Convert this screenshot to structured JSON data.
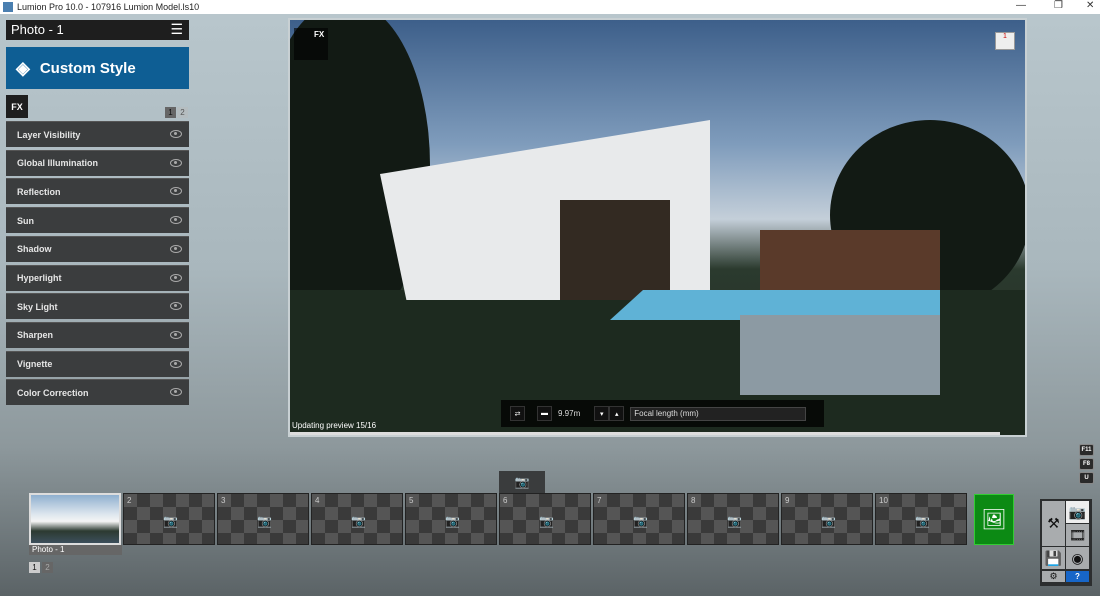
{
  "window": {
    "title": "Lumion Pro 10.0 - 107916 Lumion Model.ls10"
  },
  "panel": {
    "photo_title": "Photo - 1",
    "style_name": "Custom Style",
    "fx_tab": "FX",
    "pages": [
      "1",
      "2"
    ],
    "effects": [
      "Layer Visibility",
      "Global Illumination",
      "Reflection",
      "Sun",
      "Shadow",
      "Hyperlight",
      "Sky Light",
      "Sharpen",
      "Vignette",
      "Color Correction"
    ]
  },
  "viewport": {
    "status": "Updating preview 15/16",
    "fx_badge": "FX",
    "camera_height": "9.97m",
    "focal_length_label": "Focal length (mm)",
    "preview_badge": "1"
  },
  "keys": [
    "F11",
    "F8",
    "U"
  ],
  "filmstrip": {
    "slots": [
      "",
      "2",
      "3",
      "4",
      "5",
      "6",
      "7",
      "8",
      "9",
      "10"
    ],
    "first_label": "Photo - 1",
    "pages": [
      "1",
      "2"
    ]
  },
  "right_panel": {
    "help": "?"
  },
  "colors": {
    "accent": "#0e5e94",
    "render": "#0c8a14"
  }
}
